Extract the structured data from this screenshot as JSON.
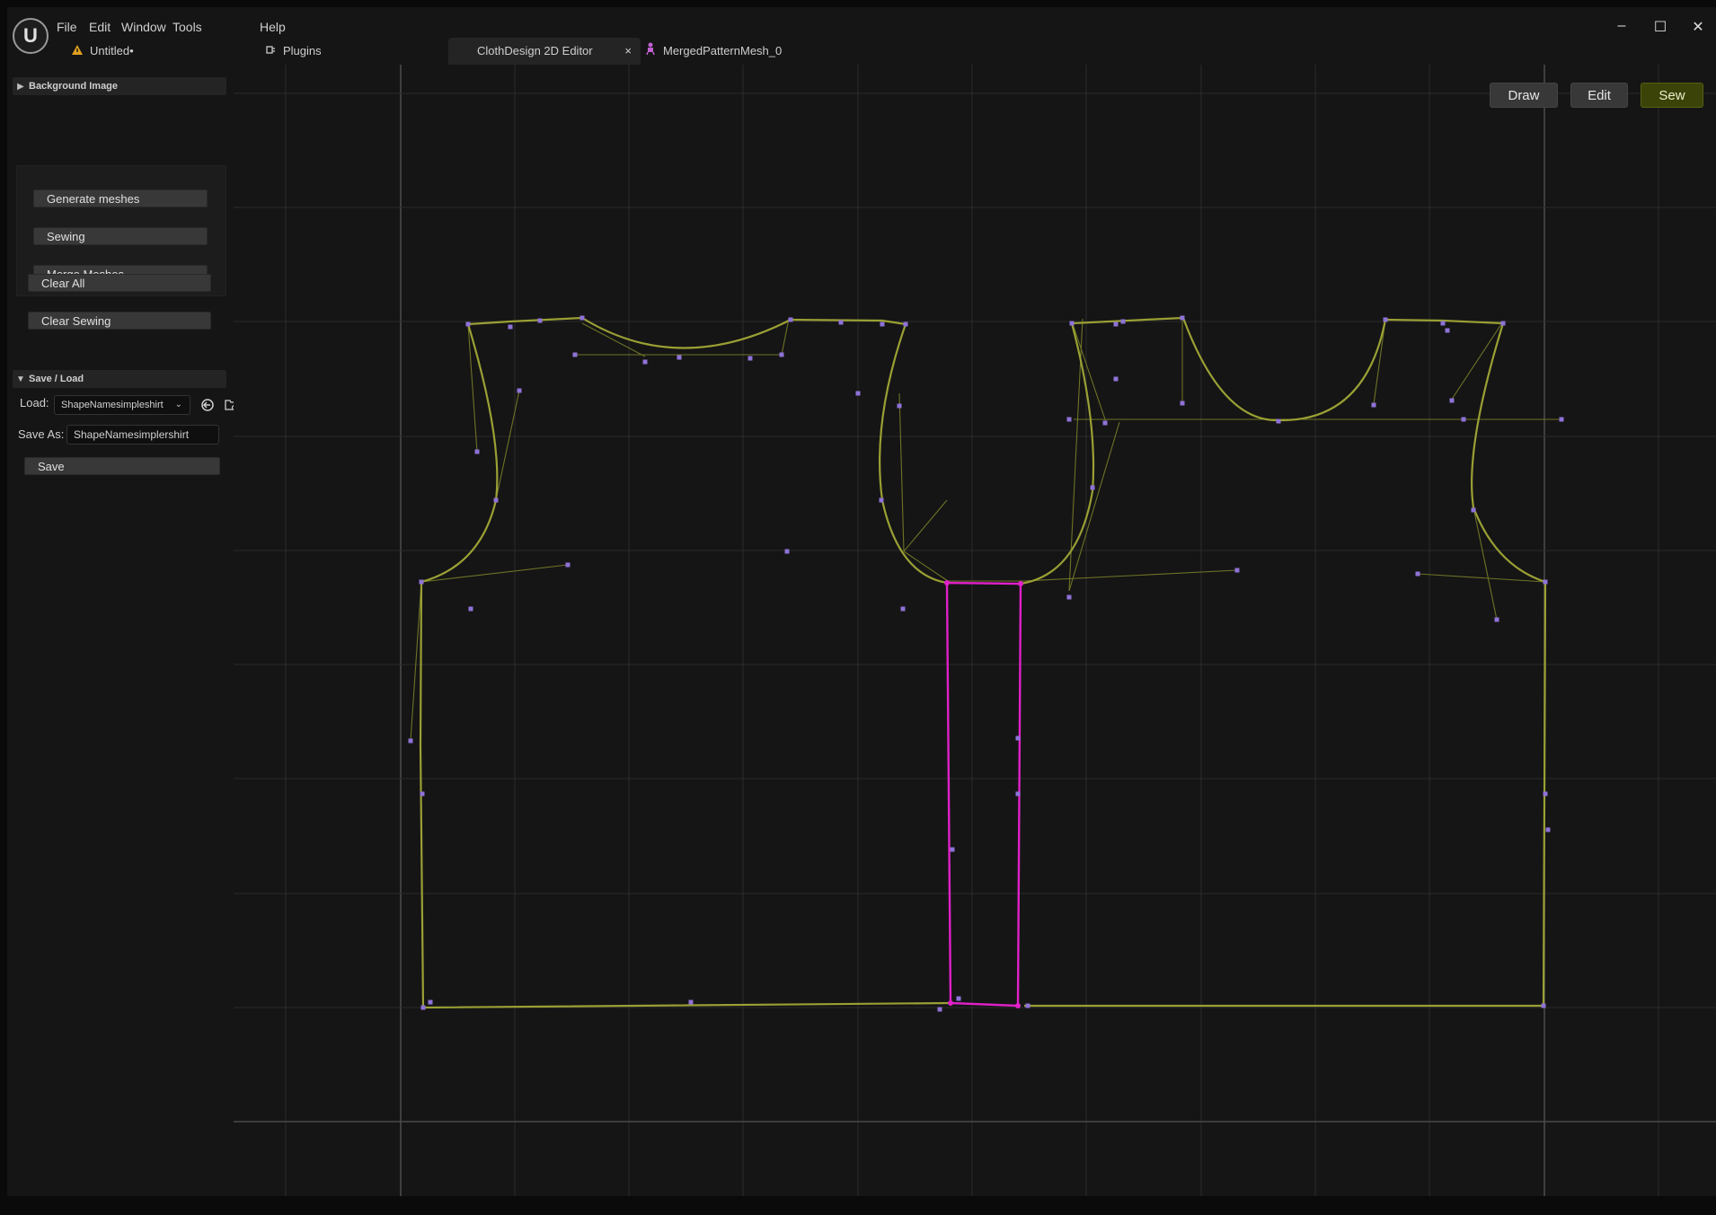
{
  "menu": [
    "File",
    "Edit",
    "Window",
    "Tools",
    "Help"
  ],
  "tabs": [
    {
      "label": "Untitled•",
      "icon": "warning-triangle-icon"
    },
    {
      "label": "Plugins",
      "icon": "plug-icon"
    },
    {
      "label": "ClothDesign 2D Editor",
      "active": true,
      "close": "×"
    },
    {
      "label": "MergedPatternMesh_0",
      "icon": "skeleton-mesh-icon"
    }
  ],
  "window_controls": {
    "minimize": "–",
    "maximize": "☐",
    "close": "✕"
  },
  "sidebar": {
    "background_header": "Background Image",
    "buttons": {
      "generate": "Generate meshes",
      "sewing": "Sewing",
      "merge": "Merge Meshes",
      "clear_all": "Clear All",
      "clear_sewing": "Clear Sewing"
    },
    "save_load": {
      "header": "Save / Load",
      "load_label": "Load:",
      "load_value": "ShapeNamesimpleshirt",
      "save_as_label": "Save As:",
      "save_as_value": "ShapeNamesimplershirt",
      "save_button": "Save"
    }
  },
  "modes": {
    "draw": "Draw",
    "edit": "Edit",
    "sew": "Sew",
    "active": "Sew"
  },
  "colors": {
    "pattern_line": "#9aa034",
    "handle_line": "#6e7326",
    "point": "#8f72d8",
    "sew_highlight": "#e020c8",
    "grid_major": "#4a4a4a",
    "grid_minor": "#2b2b2b",
    "background": "#151515"
  }
}
